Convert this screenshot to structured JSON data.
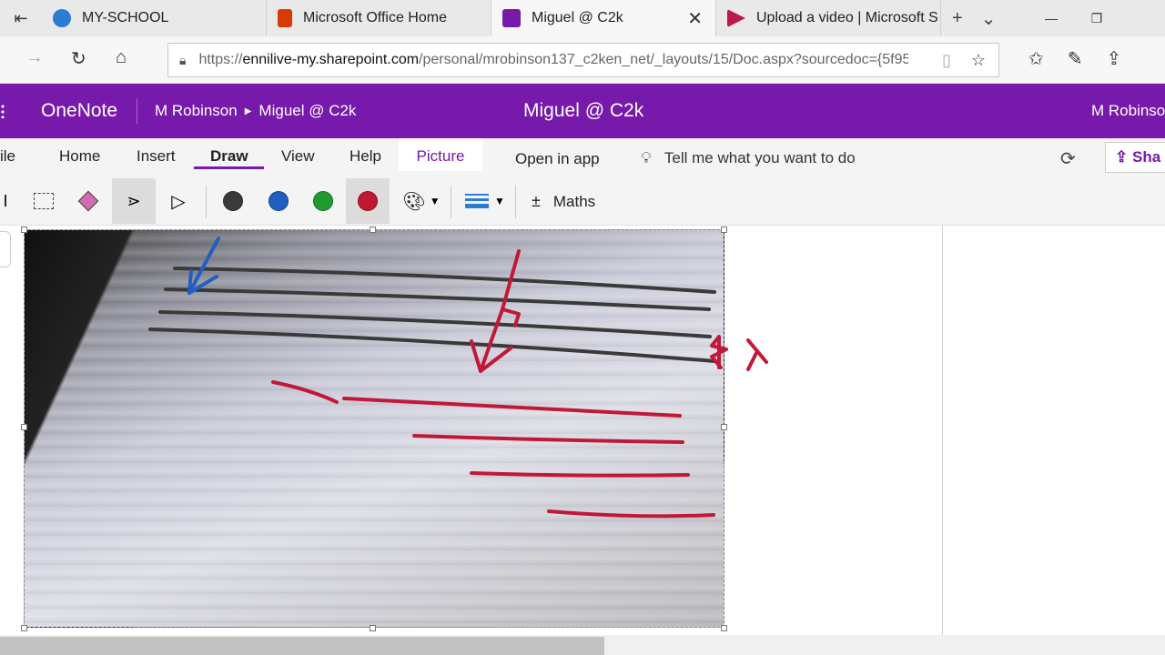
{
  "browser": {
    "tabs": [
      {
        "title": "MY-SCHOOL",
        "favicon_color": "#2b7cd3"
      },
      {
        "title": "Microsoft Office Home",
        "favicon_color": "#d83b01"
      },
      {
        "title": "Miguel @ C2k",
        "favicon_color": "#7719aa",
        "active": true
      },
      {
        "title": "Upload a video | Microsoft S",
        "favicon_color": "#bc1948"
      }
    ],
    "url_prefix": "https://",
    "url_host": "ennilive-my.sharepoint.com",
    "url_path": "/personal/mrobinson137_c2ken_net/_layouts/15/Doc.aspx?sourcedoc={5f95"
  },
  "onenote": {
    "app_name": "OneNote",
    "breadcrumb": [
      "M Robinson",
      "Miguel @ C2k"
    ],
    "page_title": "Miguel @ C2k",
    "user": "M Robinson",
    "brand_color": "#7719aa"
  },
  "ribbon": {
    "tabs": [
      "ile",
      "Home",
      "Insert",
      "Draw",
      "View",
      "Help",
      "Picture"
    ],
    "open_in_app": "Open in app",
    "tell_me": "Tell me what you want to do",
    "share": "Sha",
    "maths": "Maths",
    "pen_colors": [
      "#3a3a3a",
      "#1f5fbf",
      "#1e9a2e",
      "#c0182f"
    ]
  },
  "ink": {
    "annotation_symbol": "λ",
    "colors": {
      "black": "#3a3a3a",
      "blue": "#2060c0",
      "red": "#c21838"
    }
  }
}
